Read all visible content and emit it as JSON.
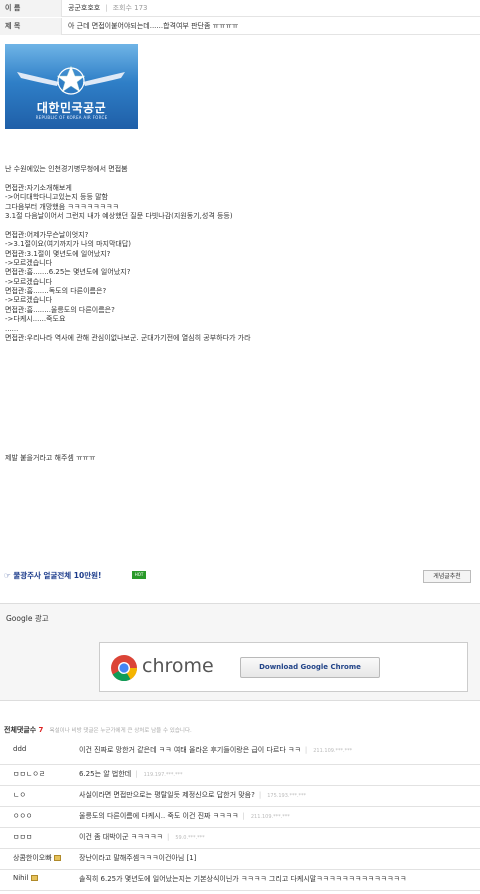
{
  "post": {
    "name_label": "이 름",
    "author": "공군호호호",
    "views_label": "조회수",
    "views": "173",
    "subject_label": "제 목",
    "subject": "아 근데 면접이붙어야되는데......합격여부 판단좀 ㅠㅠㅠㅠ"
  },
  "logo": {
    "title": "대한민국공군",
    "subtitle": "REPUBLIC OF KOREA AIR FORCE"
  },
  "body_lines": [
    "난 수원에있는 인천경기병무청에서 면접봄",
    "",
    "면접관:자기소개해보게",
    "->어디대학다니고있는지 등등 말함",
    "그다음부터 개망했음 ㅋㅋㅋㅋㅋㅋㅋㅋ",
    "3.1절 다음날이어서 그런지 내가 예상했던 질문 다빗나감(지원동기,성격 등등)",
    "",
    "면접관:어제가무슨날이엇지?",
    "->3.1절이요(여기까지가 나의 마지막대답)",
    "면접관:3.1절이 몇년도에 일어났지?",
    "->모르겠습니다",
    "면접관:흠.......6.25는 몇년도에 일어났지?",
    "->모르겠습니다",
    "면접관:흠.......독도의 다른이름은?",
    "->모르겠습니다",
    "면접관:흠........울릉도의 다른이름은?",
    "->다케시......죽도요",
    "......",
    "면접관:우리나라 역사에 관해 관심이없나보군. 군대가기전에 열심히 공부하다가 가라"
  ],
  "closing": "제발 붙을거라고 해주셈 ㅠㅠㅠ",
  "promo": {
    "text": "물광주사 얼굴전체 10만원!",
    "badge": "HOT",
    "recommend_button": "게념글추천"
  },
  "google_ad": {
    "label": "Google 광고",
    "brand": "chrome",
    "button": "Download Google Chrome"
  },
  "comments_header": {
    "title": "전체댓글수",
    "count": "7",
    "note": "욕설이나 비방 댓글은 누군가에게 큰 상처로 남을 수 있습니다."
  },
  "comments": [
    {
      "nick": "ddd",
      "text": "이건 진짜로 망한거 같은데 ㅋㅋ 여태 올라온 후기들이랑은 급이 다르다 ㅋㅋ",
      "ip": "211.109.***.***"
    },
    {
      "nick": "ㅁㅁㄴㅇㄹ",
      "text": "6.25는 알 법한데",
      "ip": "119.197.***.***"
    },
    {
      "nick": "ㄴㅇ",
      "text": "사실이라면 면접만으로는 평탈일듯 제정신으로 답한거 맞음?",
      "ip": "175.193.***.***"
    },
    {
      "nick": "ㅇㅇㅇ",
      "text": "울릉도의 다른이름에 다케시.. 죽도 이건 진짜 ㅋㅋㅋㅋ",
      "ip": "211.109.***.***"
    },
    {
      "nick": "ㅁㅁㅁ",
      "text": "이건 좀 대박이군 ㅋㅋㅋㅋㅋ",
      "ip": "59.0.***.***"
    },
    {
      "nick": "상콤한이오빠",
      "text": "장난이라고 말해주셈ㅋㅋㅋ이건아님 [1]",
      "ip": ""
    },
    {
      "nick": "Nihil",
      "text": "솔직히 6.25가 몇년도에 일어났는지는 기본상식이닌가 ㅋㅋㅋㅋ 그리고 다케시말ㅋㅋㅋㅋㅋㅋㅋㅋㅋㅋㅋㅋㅋㅋ",
      "ip": ""
    }
  ]
}
